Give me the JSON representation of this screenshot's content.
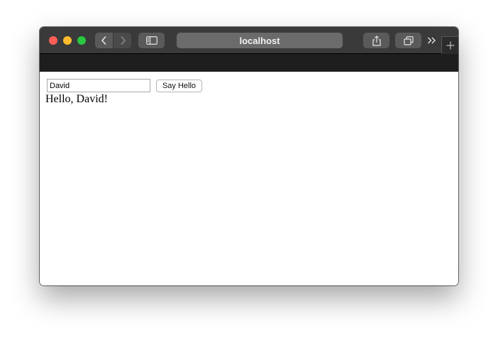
{
  "browser": {
    "address": "localhost",
    "icons": {
      "back": "chevron-left-icon",
      "forward": "chevron-right-icon",
      "sidebar": "sidebar-icon",
      "share": "share-icon",
      "tabs": "tab-overview-icon",
      "more": "double-chevron-right-icon",
      "new_tab": "plus-icon"
    },
    "colors": {
      "close": "#fe5f57",
      "minimize": "#febc2e",
      "maximize": "#28c840",
      "toolbar": "#3a3a3a"
    }
  },
  "page": {
    "name_input_value": "David",
    "button_label": "Say Hello",
    "greeting": "Hello, David!"
  }
}
